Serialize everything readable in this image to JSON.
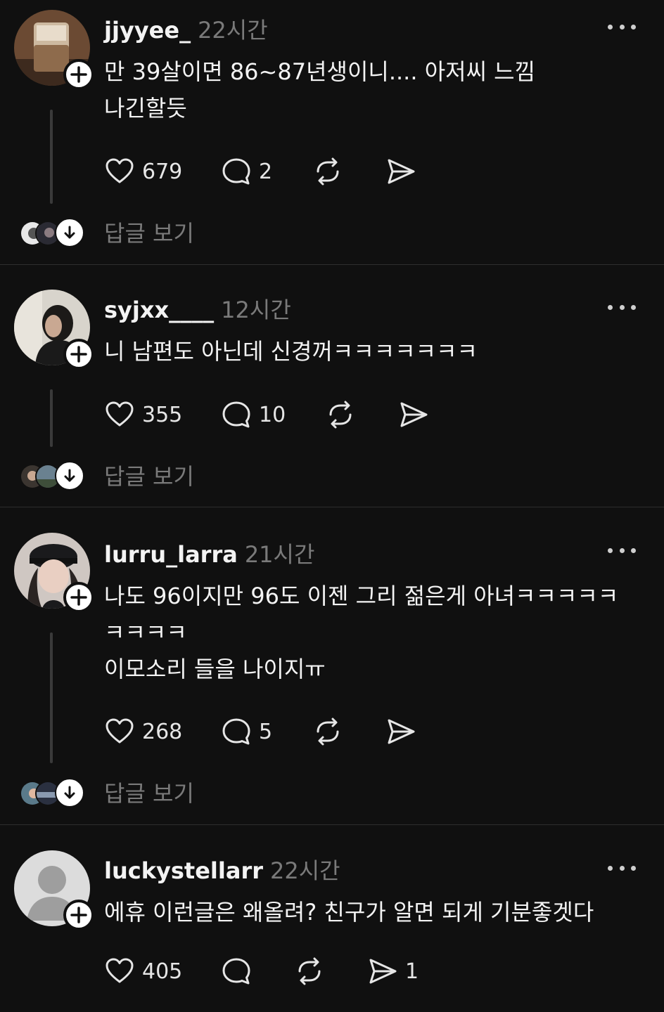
{
  "colors": {
    "background": "#101010",
    "text": "#f3f3f3",
    "muted": "#7a7a7a",
    "divider": "#2e2e2e"
  },
  "posts": [
    {
      "username": "jjyyee_",
      "time": "22시간",
      "lines": [
        "만 39살이면 86~87년생이니.... 아저씨 느낌",
        "나긴할듯"
      ],
      "likes": "679",
      "comments": "2",
      "shares": "",
      "reply_label": "답글 보기"
    },
    {
      "username": "syjxx____",
      "time": "12시간",
      "lines": [
        "니 남편도 아닌데 신경꺼ㅋㅋㅋㅋㅋㅋㅋ"
      ],
      "likes": "355",
      "comments": "10",
      "shares": "",
      "reply_label": "답글 보기"
    },
    {
      "username": "lurru_larra",
      "time": "21시간",
      "lines": [
        "나도 96이지만 96도 이젠 그리 젊은게 아녀ㅋㅋㅋㅋㅋ",
        "ㅋㅋㅋㅋ",
        "이모소리 들을 나이지ㅠ"
      ],
      "likes": "268",
      "comments": "5",
      "shares": "",
      "reply_label": "답글 보기"
    },
    {
      "username": "luckystellarr",
      "time": "22시간",
      "lines": [
        "에휴 이런글은 왜올려? 친구가 알면 되게 기분좋겟다"
      ],
      "likes": "405",
      "comments": "",
      "shares": "1",
      "reply_label": ""
    }
  ],
  "icons": {
    "like": "heart-icon",
    "comment": "comment-bubble-icon",
    "repost": "repost-icon",
    "share": "send-icon",
    "follow": "plus-icon",
    "more": "more-dots-icon",
    "expand": "arrow-down-icon"
  }
}
